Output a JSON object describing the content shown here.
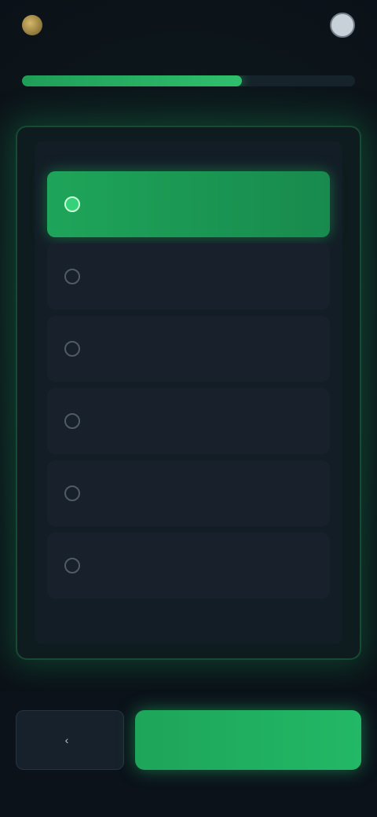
{
  "header": {
    "brand_name": "",
    "account_label": ""
  },
  "progress": {
    "fraction": 0.66
  },
  "question": {
    "text": ""
  },
  "options": [
    {
      "label": "",
      "selected": true
    },
    {
      "label": "",
      "selected": false
    },
    {
      "label": "",
      "selected": false
    },
    {
      "label": "",
      "selected": false
    },
    {
      "label": "",
      "selected": false
    },
    {
      "label": "",
      "selected": false
    }
  ],
  "footer": {
    "back_label": "",
    "continue_label": ""
  },
  "colors": {
    "accent": "#1ea55a",
    "background": "#0b1118"
  }
}
